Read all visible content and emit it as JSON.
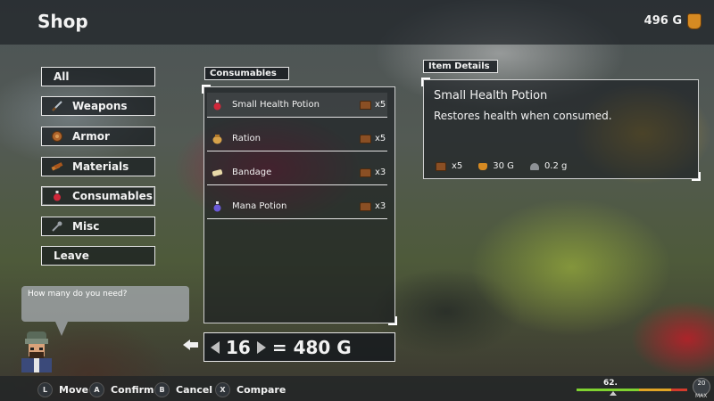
{
  "header": {
    "title": "Shop",
    "gold": "496 G",
    "gold_icon": "gold-bag-icon"
  },
  "categories": [
    {
      "label": "All",
      "icon": ""
    },
    {
      "label": "Weapons",
      "icon": "sword-icon"
    },
    {
      "label": "Armor",
      "icon": "shield-icon"
    },
    {
      "label": "Materials",
      "icon": "materials-icon"
    },
    {
      "label": "Consumables",
      "icon": "potion-icon"
    },
    {
      "label": "Misc",
      "icon": "key-icon"
    },
    {
      "label": "Leave",
      "icon": ""
    }
  ],
  "selected_category": "Consumables",
  "item_list": {
    "title": "Consumables",
    "items": [
      {
        "name": "Small Health Potion",
        "qty": "x5",
        "icon": "red-potion-icon"
      },
      {
        "name": "Ration",
        "qty": "x5",
        "icon": "ration-bag-icon"
      },
      {
        "name": "Bandage",
        "qty": "x3",
        "icon": "bandage-icon"
      },
      {
        "name": "Mana Potion",
        "qty": "x3",
        "icon": "blue-potion-icon"
      }
    ]
  },
  "details": {
    "title": "Item Details",
    "name": "Small Health Potion",
    "description": "Restores health when consumed.",
    "owned": "x5",
    "price": "30 G",
    "weight": "0.2 g"
  },
  "dialog": {
    "text": "How many do you need?"
  },
  "quantity": {
    "count": "16",
    "total": "= 480 G"
  },
  "controls": [
    {
      "button": "L",
      "label": "Move"
    },
    {
      "button": "A",
      "label": "Confirm"
    },
    {
      "button": "B",
      "label": "Cancel"
    },
    {
      "button": "X",
      "label": "Compare"
    }
  ],
  "status": {
    "exp_value": "62.",
    "level": "20",
    "level_max_label": "MAX"
  },
  "colors": {
    "accent_green": "#7fd231",
    "accent_yellow": "#e0a526",
    "accent_red": "#d33b2c",
    "gold": "#d68a22"
  }
}
